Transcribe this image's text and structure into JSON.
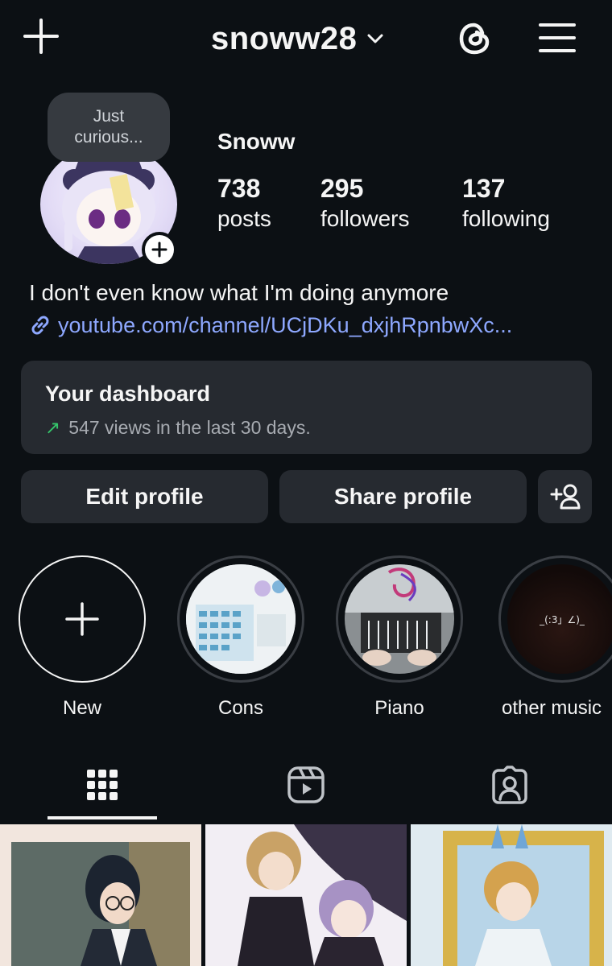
{
  "header": {
    "username": "snoww28"
  },
  "profile": {
    "note": [
      "Just",
      "curious..."
    ],
    "display_name": "Snoww",
    "stats": [
      {
        "value": "738",
        "label": "posts"
      },
      {
        "value": "295",
        "label": "followers"
      },
      {
        "value": "137",
        "label": "following"
      }
    ],
    "bio": "I don't even know what I'm doing anymore",
    "link": "youtube.com/channel/UCjDKu_dxjhRpnbwXc..."
  },
  "dashboard": {
    "title": "Your dashboard",
    "arrow": "↗",
    "subtitle": "547 views in the last 30 days."
  },
  "actions": {
    "edit": "Edit profile",
    "share": "Share profile"
  },
  "highlights": [
    {
      "label": "New"
    },
    {
      "label": "Cons"
    },
    {
      "label": "Piano"
    },
    {
      "label": "other music",
      "cover_text": "_(:3」∠)_"
    }
  ],
  "tabs": [
    "grid-icon",
    "reels-icon",
    "tagged-icon"
  ],
  "colors": {
    "background": "#0c1014",
    "surface": "#262a30",
    "link": "#8ea8ff",
    "trend_up": "#35c46a"
  }
}
